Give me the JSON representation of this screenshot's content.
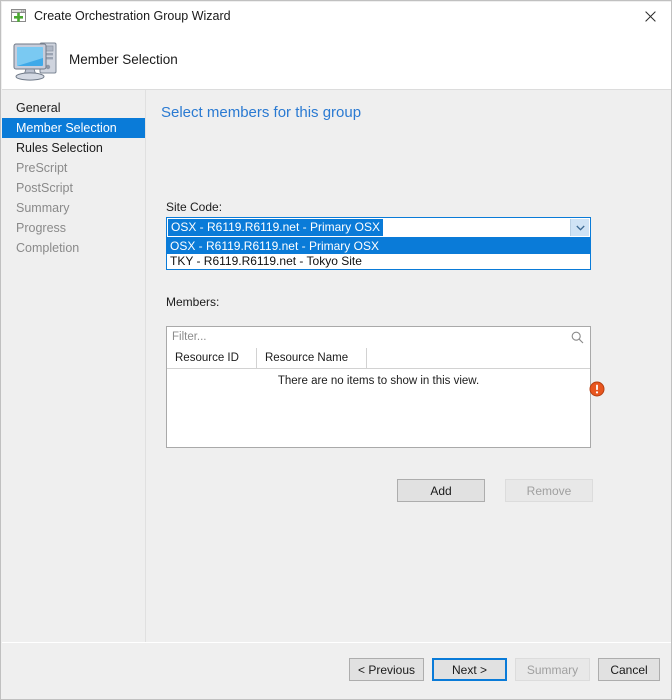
{
  "window": {
    "title": "Create Orchestration Group Wizard",
    "title_icon": "new-window-icon",
    "close_icon": "close-icon"
  },
  "wizard_header": {
    "icon": "computer-icon",
    "title": "Member Selection"
  },
  "sidebar": {
    "items": [
      {
        "label": "General",
        "state": "enabled"
      },
      {
        "label": "Member Selection",
        "state": "selected"
      },
      {
        "label": "Rules Selection",
        "state": "enabled"
      },
      {
        "label": "PreScript",
        "state": "disabled"
      },
      {
        "label": "PostScript",
        "state": "disabled"
      },
      {
        "label": "Summary",
        "state": "disabled"
      },
      {
        "label": "Progress",
        "state": "disabled"
      },
      {
        "label": "Completion",
        "state": "disabled"
      }
    ]
  },
  "content": {
    "heading": "Select members for this group",
    "site_code": {
      "label": "Site Code:",
      "selected_value": "OSX - R6119.R6119.net - Primary OSX",
      "expanded": true,
      "options": [
        "OSX - R6119.R6119.net - Primary OSX",
        "TKY - R6119.R6119.net - Tokyo Site"
      ],
      "arrow_icon": "chevron-down-icon"
    },
    "members": {
      "label": "Members:",
      "filter_placeholder": "Filter...",
      "search_icon": "search-icon",
      "columns": [
        "Resource ID",
        "Resource Name"
      ],
      "rows": [],
      "empty_message": "There are no items to show in this view."
    },
    "validation": {
      "icon": "error-icon",
      "color": "#e8561f"
    },
    "add_label": "Add",
    "remove_label": "Remove"
  },
  "footer": {
    "previous_label": "< Previous",
    "next_label": "Next >",
    "summary_label": "Summary",
    "cancel_label": "Cancel"
  },
  "colors": {
    "accent": "#0a7bd8",
    "heading": "#2a7ad2",
    "window_bg": "#efefef",
    "error": "#e8561f"
  }
}
